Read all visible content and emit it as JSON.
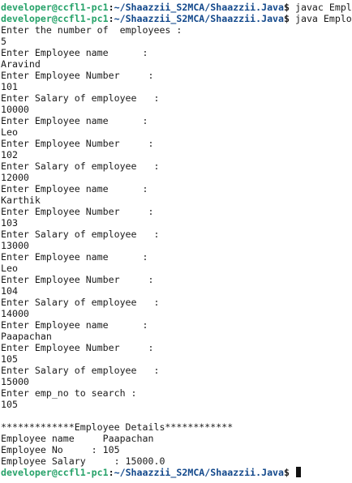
{
  "prompt": {
    "user_host": "developer@ccfl1-pc1",
    "separator": ":",
    "path": "~/Shaazzii_S2MCA/Shaazzii.Java",
    "dollar": "$"
  },
  "commands": {
    "compile": " javac Employee.java",
    "run": " java Employee"
  },
  "output": [
    "Enter the number of  employees :",
    "5",
    "Enter Employee name      :",
    "Aravind",
    "Enter Employee Number     :",
    "101",
    "Enter Salary of employee   :",
    "10000",
    "Enter Employee name      :",
    "Leo",
    "Enter Employee Number     :",
    "102",
    "Enter Salary of employee   :",
    "12000",
    "Enter Employee name      :",
    "Karthik",
    "Enter Employee Number     :",
    "103",
    "Enter Salary of employee   :",
    "13000",
    "Enter Employee name      :",
    "Leo",
    "Enter Employee Number     :",
    "104",
    "Enter Salary of employee   :",
    "14000",
    "Enter Employee name      :",
    "Paapachan",
    "Enter Employee Number     :",
    "105",
    "Enter Salary of employee   :",
    "15000",
    "Enter emp_no to search :",
    "105",
    "",
    "*************Employee Details************",
    "Employee name     Paapachan",
    "Employee No     : 105",
    "Employee Salary     : 15000.0"
  ],
  "colors": {
    "background": "#ffffff",
    "text": "#1a1a1a",
    "prompt_user": "#26a269",
    "prompt_path": "#12488b"
  }
}
